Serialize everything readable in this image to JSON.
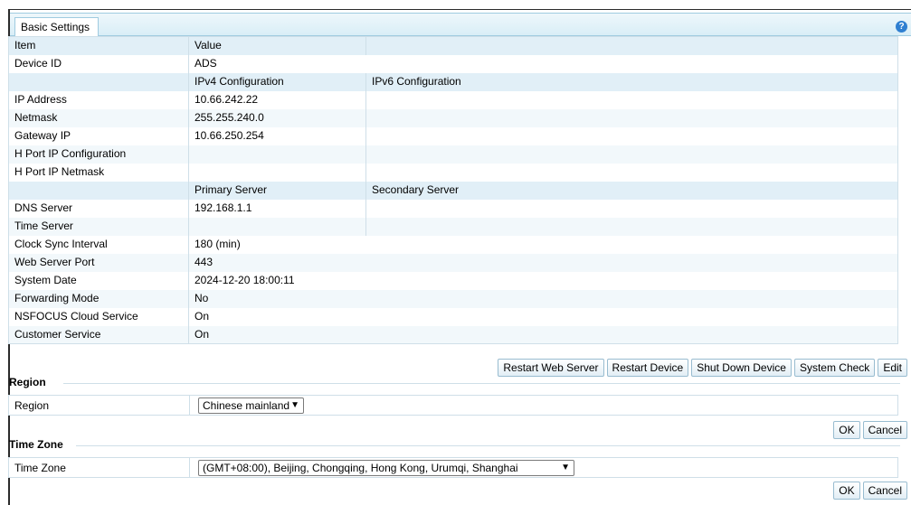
{
  "tab": {
    "label": "Basic Settings"
  },
  "help_icon": "?",
  "table": {
    "header": [
      "Item",
      "Value"
    ],
    "rows": [
      {
        "item": "Device ID",
        "v1": "ADS",
        "v2": "",
        "type": "span"
      },
      {
        "item": "",
        "v1": "IPv4 Configuration",
        "v2": "IPv6 Configuration",
        "type": "sub"
      },
      {
        "item": "IP Address",
        "v1": "10.66.242.22",
        "v2": "",
        "type": "split"
      },
      {
        "item": "Netmask",
        "v1": "255.255.240.0",
        "v2": "",
        "type": "split"
      },
      {
        "item": "Gateway IP",
        "v1": "10.66.250.254",
        "v2": "",
        "type": "split"
      },
      {
        "item": "H Port IP Configuration",
        "v1": "",
        "v2": "",
        "type": "split"
      },
      {
        "item": "H Port IP Netmask",
        "v1": "",
        "v2": "",
        "type": "split"
      },
      {
        "item": "",
        "v1": "Primary Server",
        "v2": "Secondary Server",
        "type": "sub"
      },
      {
        "item": "DNS Server",
        "v1": "192.168.1.1",
        "v2": "",
        "type": "split"
      },
      {
        "item": "Time Server",
        "v1": "",
        "v2": "",
        "type": "split"
      },
      {
        "item": "Clock Sync Interval",
        "v1": "180 (min)",
        "v2": "",
        "type": "span"
      },
      {
        "item": "Web Server Port",
        "v1": "443",
        "v2": "",
        "type": "span"
      },
      {
        "item": "System Date",
        "v1": "2024-12-20 18:00:11",
        "v2": "",
        "type": "span"
      },
      {
        "item": "Forwarding Mode",
        "v1": "No",
        "v2": "",
        "type": "span"
      },
      {
        "item": "NSFOCUS Cloud Service",
        "v1": "On",
        "v2": "",
        "type": "span"
      },
      {
        "item": "Customer Service",
        "v1": "On",
        "v2": "",
        "type": "span"
      }
    ]
  },
  "actions": {
    "restart_web_server": "Restart Web Server",
    "restart_device": "Restart Device",
    "shut_down_device": "Shut Down Device",
    "system_check": "System Check",
    "edit": "Edit"
  },
  "region": {
    "section_title": "Region",
    "label": "Region",
    "value": "Chinese mainland",
    "ok": "OK",
    "cancel": "Cancel"
  },
  "timezone": {
    "section_title": "Time Zone",
    "label": "Time Zone",
    "value": "(GMT+08:00), Beijing, Chongqing, Hong Kong, Urumqi, Shanghai",
    "ok": "OK",
    "cancel": "Cancel"
  }
}
